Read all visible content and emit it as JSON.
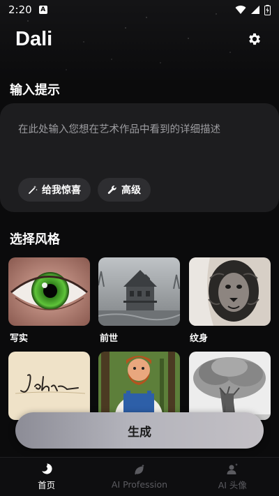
{
  "status_bar": {
    "time": "2:20",
    "notification_letter": "A"
  },
  "header": {
    "title": "Dali"
  },
  "prompt": {
    "section_title": "输入提示",
    "placeholder": "在此处输入您想在艺术作品中看到的详细描述",
    "surprise_label": "给我惊喜",
    "advanced_label": "高级"
  },
  "styles": {
    "section_title": "选择风格",
    "items": [
      {
        "label": "写实",
        "image": "green-eye-closeup"
      },
      {
        "label": "前世",
        "image": "foggy-old-house"
      },
      {
        "label": "纹身",
        "image": "lion-tattoo-arm"
      },
      {
        "label": "",
        "image": "john-signature"
      },
      {
        "label": "",
        "image": "cartoon-bearded-man"
      },
      {
        "label": "",
        "image": "pencil-tree-sketch"
      }
    ]
  },
  "generate": {
    "label": "生成"
  },
  "bottom_nav": {
    "items": [
      {
        "label": "首页",
        "icon": "home-swirl-icon",
        "active": true
      },
      {
        "label": "AI Profession",
        "icon": "leaf-sparkle-icon",
        "active": false
      },
      {
        "label": "AI 头像",
        "icon": "user-sparkle-icon",
        "active": false
      }
    ]
  },
  "colors": {
    "background": "#0b0b0c",
    "card": "#1d1d1f",
    "chip": "#2e2e31",
    "nav_inactive": "#5b5b60"
  }
}
